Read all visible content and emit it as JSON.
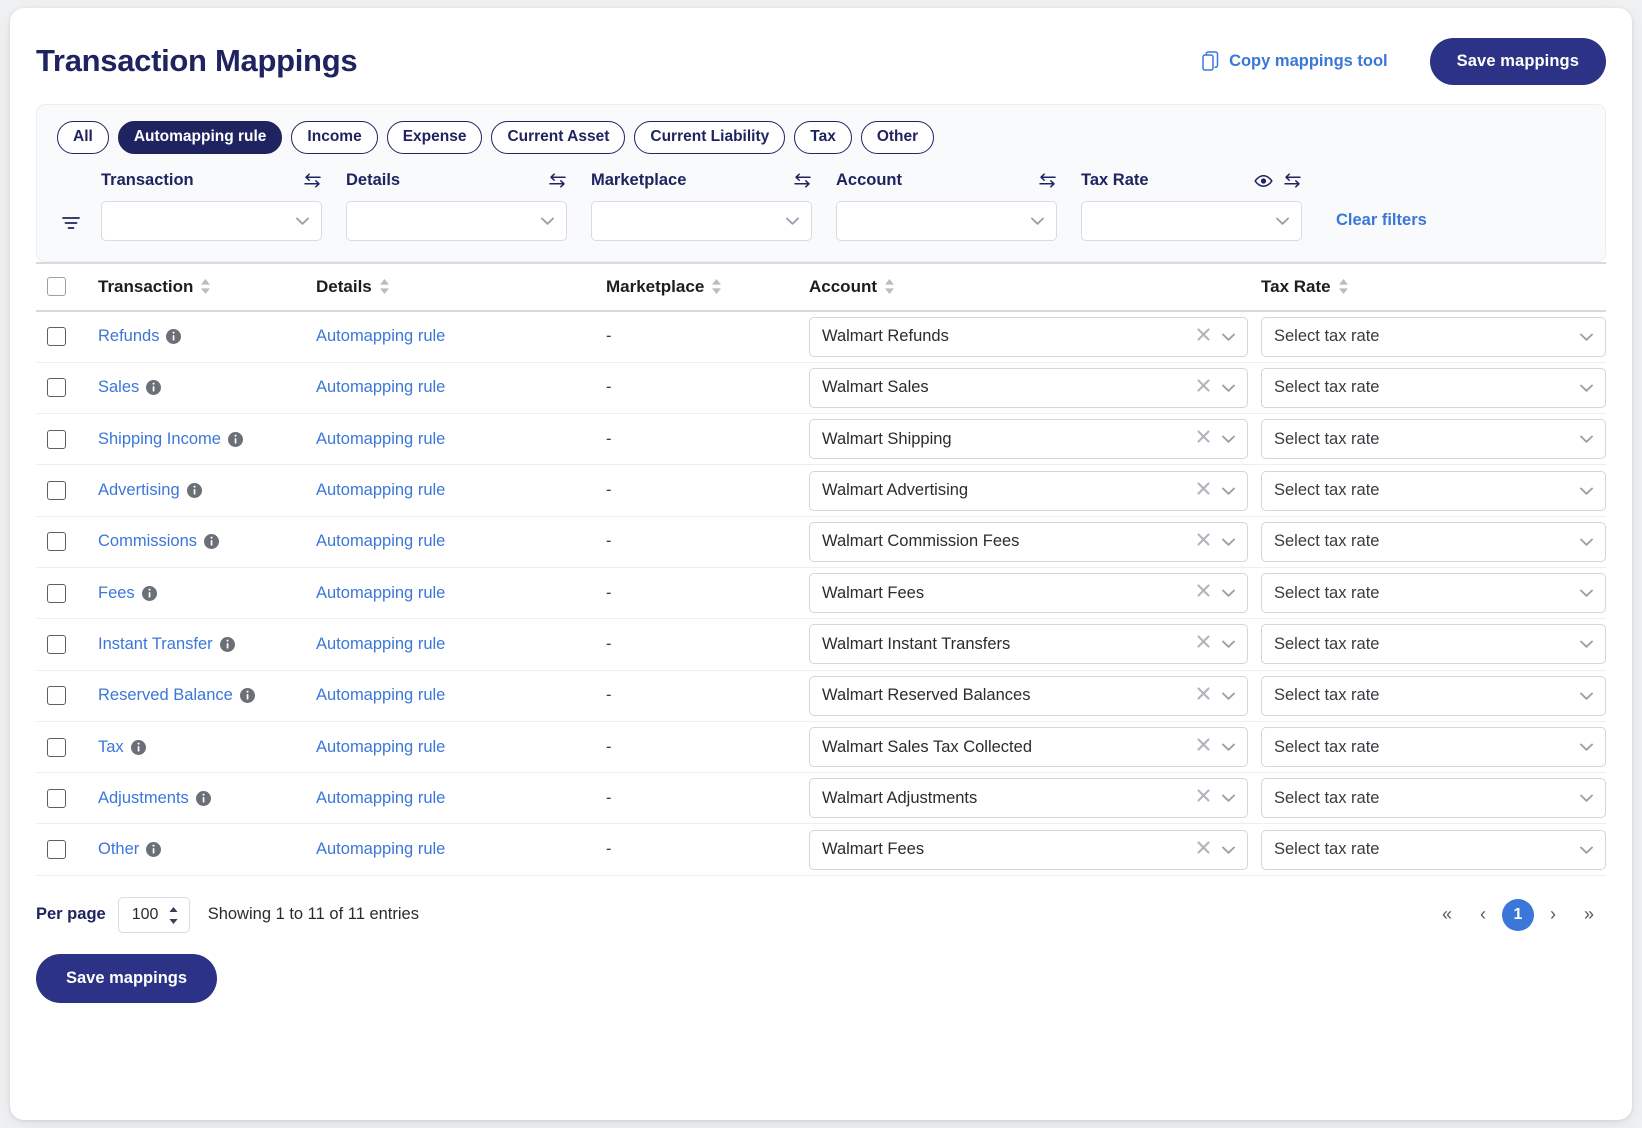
{
  "header": {
    "title": "Transaction Mappings",
    "copy_tool_label": "Copy mappings tool",
    "save_label": "Save mappings"
  },
  "filters": {
    "chips": [
      {
        "label": "All",
        "active": false
      },
      {
        "label": "Automapping rule",
        "active": true
      },
      {
        "label": "Income",
        "active": false
      },
      {
        "label": "Expense",
        "active": false
      },
      {
        "label": "Current Asset",
        "active": false
      },
      {
        "label": "Current Liability",
        "active": false
      },
      {
        "label": "Tax",
        "active": false
      },
      {
        "label": "Other",
        "active": false
      }
    ],
    "columns": [
      {
        "label": "Transaction",
        "value": "",
        "has_eye": false
      },
      {
        "label": "Details",
        "value": "",
        "has_eye": false
      },
      {
        "label": "Marketplace",
        "value": "",
        "has_eye": false
      },
      {
        "label": "Account",
        "value": "",
        "has_eye": false
      },
      {
        "label": "Tax Rate",
        "value": "",
        "has_eye": true
      }
    ],
    "clear_label": "Clear filters"
  },
  "table": {
    "headers": [
      "Transaction",
      "Details",
      "Marketplace",
      "Account",
      "Tax Rate"
    ],
    "tax_placeholder": "Select tax rate",
    "rows": [
      {
        "transaction": "Refunds",
        "details": "Automapping rule",
        "marketplace": "-",
        "account": "Walmart Refunds",
        "tax_rate": ""
      },
      {
        "transaction": "Sales",
        "details": "Automapping rule",
        "marketplace": "-",
        "account": "Walmart Sales",
        "tax_rate": ""
      },
      {
        "transaction": "Shipping Income",
        "details": "Automapping rule",
        "marketplace": "-",
        "account": "Walmart Shipping",
        "tax_rate": ""
      },
      {
        "transaction": "Advertising",
        "details": "Automapping rule",
        "marketplace": "-",
        "account": "Walmart Advertising",
        "tax_rate": ""
      },
      {
        "transaction": "Commissions",
        "details": "Automapping rule",
        "marketplace": "-",
        "account": "Walmart Commission Fees",
        "tax_rate": ""
      },
      {
        "transaction": "Fees",
        "details": "Automapping rule",
        "marketplace": "-",
        "account": "Walmart Fees",
        "tax_rate": ""
      },
      {
        "transaction": "Instant Transfer",
        "details": "Automapping rule",
        "marketplace": "-",
        "account": "Walmart Instant Transfers",
        "tax_rate": ""
      },
      {
        "transaction": "Reserved Balance",
        "details": "Automapping rule",
        "marketplace": "-",
        "account": "Walmart Reserved Balances",
        "tax_rate": ""
      },
      {
        "transaction": "Tax",
        "details": "Automapping rule",
        "marketplace": "-",
        "account": "Walmart Sales Tax Collected",
        "tax_rate": ""
      },
      {
        "transaction": "Adjustments",
        "details": "Automapping rule",
        "marketplace": "-",
        "account": "Walmart Adjustments",
        "tax_rate": ""
      },
      {
        "transaction": "Other",
        "details": "Automapping rule",
        "marketplace": "-",
        "account": "Walmart Fees",
        "tax_rate": ""
      }
    ]
  },
  "footer": {
    "per_page_label": "Per page",
    "per_page_value": "100",
    "showing_text": "Showing 1 to 11 of 11 entries",
    "pagination": {
      "first": "«",
      "prev": "‹",
      "current": "1",
      "next": "›",
      "last": "»"
    },
    "save_label": "Save mappings"
  },
  "colors": {
    "brand_navy": "#1f2460",
    "button_navy": "#2c3285",
    "link_blue": "#3b77d8",
    "panel_bg": "#f9fafb"
  }
}
